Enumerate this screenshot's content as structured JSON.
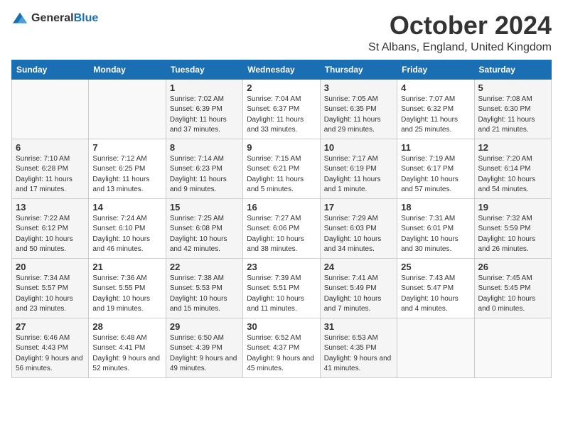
{
  "logo": {
    "general": "General",
    "blue": "Blue"
  },
  "title": "October 2024",
  "location": "St Albans, England, United Kingdom",
  "headers": [
    "Sunday",
    "Monday",
    "Tuesday",
    "Wednesday",
    "Thursday",
    "Friday",
    "Saturday"
  ],
  "weeks": [
    [
      {
        "day": "",
        "info": ""
      },
      {
        "day": "",
        "info": ""
      },
      {
        "day": "1",
        "info": "Sunrise: 7:02 AM\nSunset: 6:39 PM\nDaylight: 11 hours and 37 minutes."
      },
      {
        "day": "2",
        "info": "Sunrise: 7:04 AM\nSunset: 6:37 PM\nDaylight: 11 hours and 33 minutes."
      },
      {
        "day": "3",
        "info": "Sunrise: 7:05 AM\nSunset: 6:35 PM\nDaylight: 11 hours and 29 minutes."
      },
      {
        "day": "4",
        "info": "Sunrise: 7:07 AM\nSunset: 6:32 PM\nDaylight: 11 hours and 25 minutes."
      },
      {
        "day": "5",
        "info": "Sunrise: 7:08 AM\nSunset: 6:30 PM\nDaylight: 11 hours and 21 minutes."
      }
    ],
    [
      {
        "day": "6",
        "info": "Sunrise: 7:10 AM\nSunset: 6:28 PM\nDaylight: 11 hours and 17 minutes."
      },
      {
        "day": "7",
        "info": "Sunrise: 7:12 AM\nSunset: 6:25 PM\nDaylight: 11 hours and 13 minutes."
      },
      {
        "day": "8",
        "info": "Sunrise: 7:14 AM\nSunset: 6:23 PM\nDaylight: 11 hours and 9 minutes."
      },
      {
        "day": "9",
        "info": "Sunrise: 7:15 AM\nSunset: 6:21 PM\nDaylight: 11 hours and 5 minutes."
      },
      {
        "day": "10",
        "info": "Sunrise: 7:17 AM\nSunset: 6:19 PM\nDaylight: 11 hours and 1 minute."
      },
      {
        "day": "11",
        "info": "Sunrise: 7:19 AM\nSunset: 6:17 PM\nDaylight: 10 hours and 57 minutes."
      },
      {
        "day": "12",
        "info": "Sunrise: 7:20 AM\nSunset: 6:14 PM\nDaylight: 10 hours and 54 minutes."
      }
    ],
    [
      {
        "day": "13",
        "info": "Sunrise: 7:22 AM\nSunset: 6:12 PM\nDaylight: 10 hours and 50 minutes."
      },
      {
        "day": "14",
        "info": "Sunrise: 7:24 AM\nSunset: 6:10 PM\nDaylight: 10 hours and 46 minutes."
      },
      {
        "day": "15",
        "info": "Sunrise: 7:25 AM\nSunset: 6:08 PM\nDaylight: 10 hours and 42 minutes."
      },
      {
        "day": "16",
        "info": "Sunrise: 7:27 AM\nSunset: 6:06 PM\nDaylight: 10 hours and 38 minutes."
      },
      {
        "day": "17",
        "info": "Sunrise: 7:29 AM\nSunset: 6:03 PM\nDaylight: 10 hours and 34 minutes."
      },
      {
        "day": "18",
        "info": "Sunrise: 7:31 AM\nSunset: 6:01 PM\nDaylight: 10 hours and 30 minutes."
      },
      {
        "day": "19",
        "info": "Sunrise: 7:32 AM\nSunset: 5:59 PM\nDaylight: 10 hours and 26 minutes."
      }
    ],
    [
      {
        "day": "20",
        "info": "Sunrise: 7:34 AM\nSunset: 5:57 PM\nDaylight: 10 hours and 23 minutes."
      },
      {
        "day": "21",
        "info": "Sunrise: 7:36 AM\nSunset: 5:55 PM\nDaylight: 10 hours and 19 minutes."
      },
      {
        "day": "22",
        "info": "Sunrise: 7:38 AM\nSunset: 5:53 PM\nDaylight: 10 hours and 15 minutes."
      },
      {
        "day": "23",
        "info": "Sunrise: 7:39 AM\nSunset: 5:51 PM\nDaylight: 10 hours and 11 minutes."
      },
      {
        "day": "24",
        "info": "Sunrise: 7:41 AM\nSunset: 5:49 PM\nDaylight: 10 hours and 7 minutes."
      },
      {
        "day": "25",
        "info": "Sunrise: 7:43 AM\nSunset: 5:47 PM\nDaylight: 10 hours and 4 minutes."
      },
      {
        "day": "26",
        "info": "Sunrise: 7:45 AM\nSunset: 5:45 PM\nDaylight: 10 hours and 0 minutes."
      }
    ],
    [
      {
        "day": "27",
        "info": "Sunrise: 6:46 AM\nSunset: 4:43 PM\nDaylight: 9 hours and 56 minutes."
      },
      {
        "day": "28",
        "info": "Sunrise: 6:48 AM\nSunset: 4:41 PM\nDaylight: 9 hours and 52 minutes."
      },
      {
        "day": "29",
        "info": "Sunrise: 6:50 AM\nSunset: 4:39 PM\nDaylight: 9 hours and 49 minutes."
      },
      {
        "day": "30",
        "info": "Sunrise: 6:52 AM\nSunset: 4:37 PM\nDaylight: 9 hours and 45 minutes."
      },
      {
        "day": "31",
        "info": "Sunrise: 6:53 AM\nSunset: 4:35 PM\nDaylight: 9 hours and 41 minutes."
      },
      {
        "day": "",
        "info": ""
      },
      {
        "day": "",
        "info": ""
      }
    ]
  ]
}
